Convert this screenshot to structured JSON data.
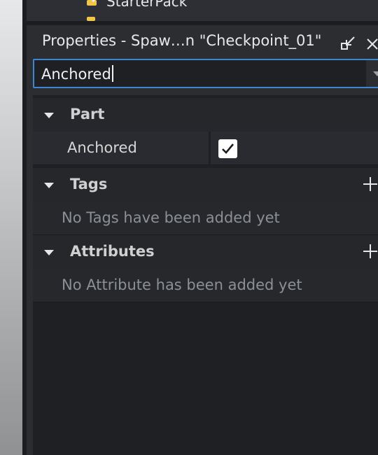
{
  "explorer": {
    "visible_item_label": "StarterPack"
  },
  "properties": {
    "title": "Properties - Spaw…n \"Checkpoint_01\"",
    "search": {
      "value": "Anchored"
    },
    "sections": [
      {
        "title": "Part",
        "rows": [
          {
            "name": "Anchored",
            "checked": true
          }
        ]
      },
      {
        "title": "Tags",
        "empty_message": "No Tags have been added yet"
      },
      {
        "title": "Attributes",
        "empty_message": "No Attribute has been added yet"
      }
    ]
  },
  "icons": {
    "dock": "dock-icon",
    "close": "close-icon",
    "collapse": "triangle-down-icon",
    "add": "plus-icon",
    "check": "checkmark-icon",
    "dropdown": "chevron-down-icon"
  },
  "colors": {
    "accent": "#3d86d6",
    "checkbox": "#ffffff"
  }
}
